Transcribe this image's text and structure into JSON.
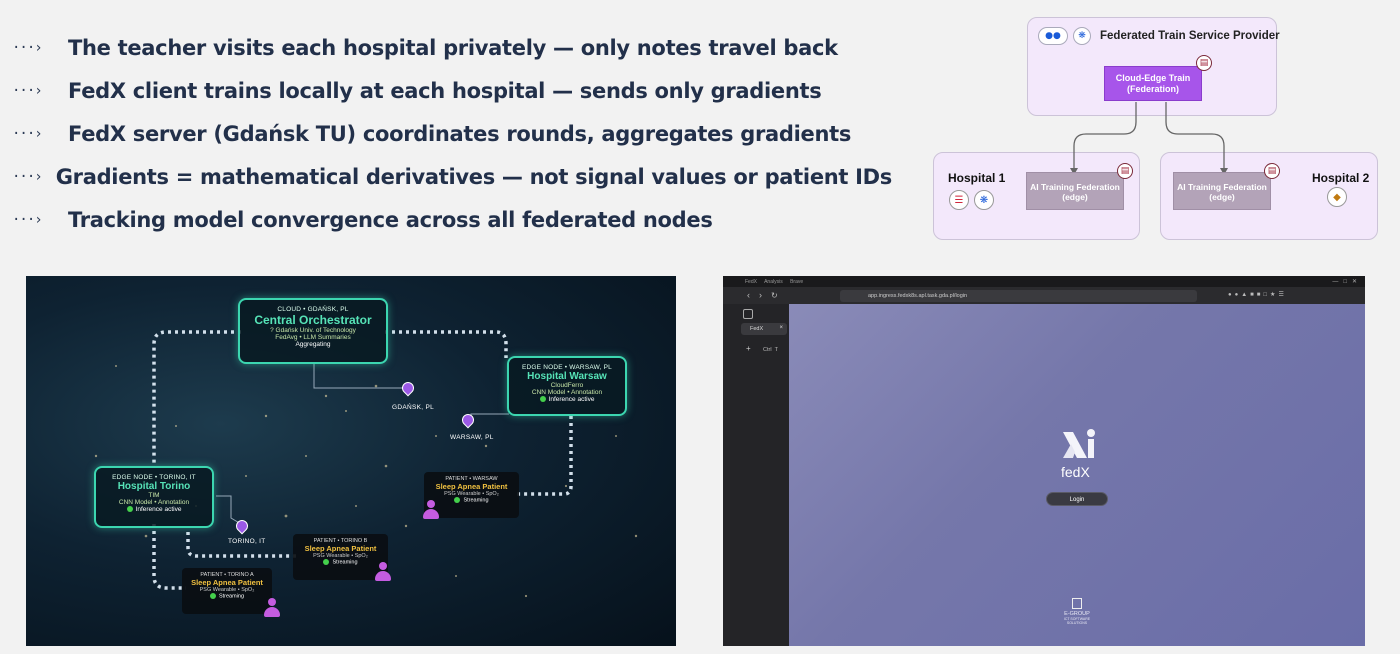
{
  "bullets": {
    "arrow": "···›",
    "items": [
      "The teacher visits each hospital privately — only notes travel back",
      "FedX client trains locally at each hospital — sends only gradients",
      "FedX server (Gdańsk TU) coordinates rounds, aggregates gradients",
      "Gradients = mathematical derivatives — not signal values or patient IDs",
      "Tracking model convergence across all federated nodes"
    ]
  },
  "diagram": {
    "provider_title": "Federated Train Service Provider",
    "cloud_train_line1": "Cloud-Edge Train",
    "cloud_train_line2": "(Federation)",
    "hospital1": "Hospital 1",
    "hospital2": "Hospital 2",
    "ai_training_line1": "AI Training Federation",
    "ai_training_line2": "(edge)"
  },
  "map": {
    "orchestrator": {
      "top": "CLOUD • GDAŃSK, PL",
      "title": "Central Orchestrator",
      "line1": "? Gdańsk Univ. of Technology",
      "line2": "FedAvg • LLM Summaries",
      "status": "Aggregating"
    },
    "warsaw": {
      "top": "EDGE NODE • WARSAW, PL",
      "title": "Hospital Warsaw",
      "line1": "CloudFerro",
      "line2": "CNN Model • Annotation",
      "status": "Inference active"
    },
    "torino": {
      "top": "EDGE NODE • TORINO, IT",
      "title": "Hospital Torino",
      "line1": "TIM",
      "line2": "CNN Model • Annotation",
      "status": "Inference active"
    },
    "patient_warsaw": {
      "top": "PATIENT • WARSAW",
      "title": "Sleep Apnea Patient",
      "line1": "PSG Wearable • SpO₂",
      "status": "Streaming"
    },
    "patient_torino_b": {
      "top": "PATIENT • TORINO B",
      "title": "Sleep Apnea Patient",
      "line1": "PSG Wearable • SpO₂",
      "status": "Streaming"
    },
    "patient_torino_a": {
      "top": "PATIENT • TORINO A",
      "title": "Sleep Apnea Patient",
      "line1": "PSG Wearable • SpO₂",
      "status": "Streaming"
    },
    "cities": {
      "gdansk": "GDAŃSK, PL",
      "warsaw": "WARSAW, PL",
      "torino": "TORINO, IT"
    }
  },
  "browser": {
    "menu": [
      "FedX",
      "Analysis",
      "Brave"
    ],
    "url": "app.ingress.fedxk8s.apl.task.gda.pl/login",
    "tab_label": "FedX",
    "ctrl_hint": "Ctrl",
    "ctrl_key": "T",
    "app_name": "fedX",
    "login_label": "Login",
    "footer_brand": "E-GROUP",
    "footer_sub": "ICT SOFTWARE SOLUTIONS"
  }
}
